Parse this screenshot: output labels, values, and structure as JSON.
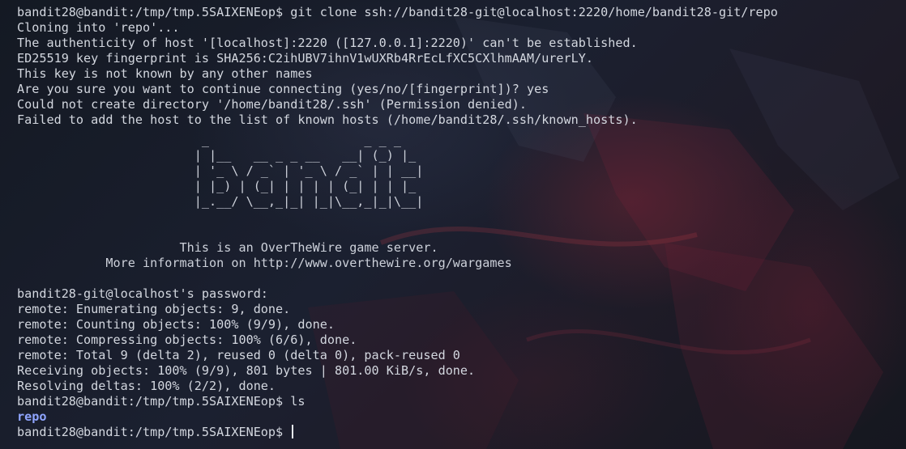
{
  "terminal": {
    "lines": [
      "bandit28@bandit:/tmp/tmp.5SAIXENEop$ git clone ssh://bandit28-git@localhost:2220/home/bandit28-git/repo",
      "Cloning into 'repo'...",
      "The authenticity of host '[localhost]:2220 ([127.0.0.1]:2220)' can't be established.",
      "ED25519 key fingerprint is SHA256:C2ihUBV7ihnV1wUXRb4RrEcLfXC5CXlhmAAM/urerLY.",
      "This key is not known by any other names",
      "Are you sure you want to continue connecting (yes/no/[fingerprint])? yes",
      "Could not create directory '/home/bandit28/.ssh' (Permission denied).",
      "Failed to add the host to the list of known hosts (/home/bandit28/.ssh/known_hosts)."
    ],
    "ascii_art": [
      "                         _                     _ _ _",
      "                        | |__   __ _ _ __   __| (_) |_",
      "                        | '_ \\ / _` | '_ \\ / _` | | __|",
      "                        | |_) | (_| | | | | (_| | | |_",
      "                        |_.__/ \\__,_|_| |_|\\__,_|_|\\__|"
    ],
    "banner": [
      "                      This is an OverTheWire game server.",
      "            More information on http://www.overthewire.org/wargames"
    ],
    "output": [
      "bandit28-git@localhost's password:",
      "remote: Enumerating objects: 9, done.",
      "remote: Counting objects: 100% (9/9), done.",
      "remote: Compressing objects: 100% (6/6), done.",
      "remote: Total 9 (delta 2), reused 0 (delta 0), pack-reused 0",
      "Receiving objects: 100% (9/9), 801 bytes | 801.00 KiB/s, done.",
      "Resolving deltas: 100% (2/2), done.",
      "bandit28@bandit:/tmp/tmp.5SAIXENEop$ ls"
    ],
    "ls_result": "repo",
    "prompt": "bandit28@bandit:/tmp/tmp.5SAIXENEop$ "
  },
  "colors": {
    "background": "#151a24",
    "text": "#d3d7df",
    "directory": "#8fa5ff",
    "accent_red": "#8c2837"
  },
  "icons": {
    "cursor": "text-cursor-bar"
  }
}
